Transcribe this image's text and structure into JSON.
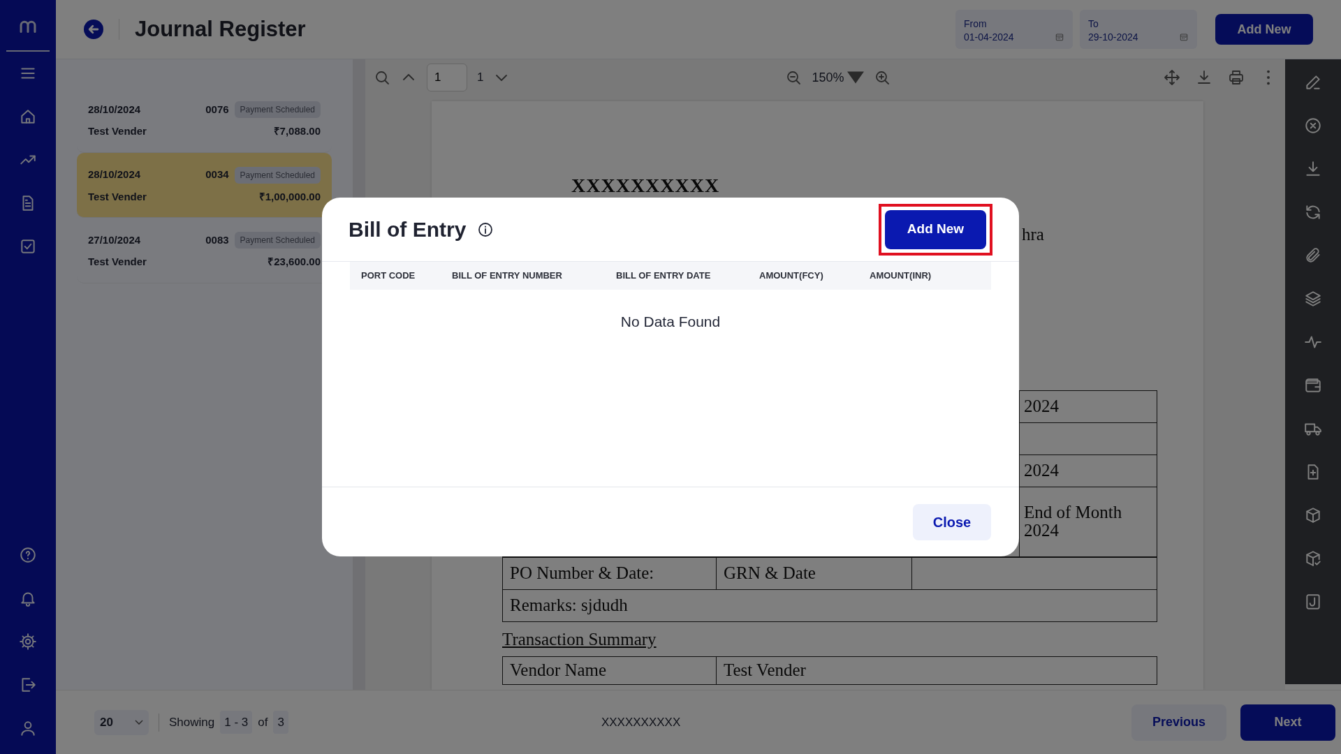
{
  "header": {
    "title": "Journal Register",
    "from": {
      "label": "From",
      "value": "01-04-2024"
    },
    "to": {
      "label": "To",
      "value": "29-10-2024"
    },
    "add_button": "Add New"
  },
  "entries": [
    {
      "date": "28/10/2024",
      "number": "0076",
      "status": "Payment Scheduled",
      "vendor": "Test Vender",
      "amount": "₹7,088.00",
      "selected": false
    },
    {
      "date": "28/10/2024",
      "number": "0034",
      "status": "Payment Scheduled",
      "vendor": "Test Vender",
      "amount": "₹1,00,000.00",
      "selected": true
    },
    {
      "date": "27/10/2024",
      "number": "0083",
      "status": "Payment Scheduled",
      "vendor": "Test Vender",
      "amount": "₹23,600.00",
      "selected": false
    }
  ],
  "viewer": {
    "page": "1",
    "page_count": "1",
    "zoom": "150%"
  },
  "document": {
    "title": "XXXXXXXXXX",
    "address_fragment": "hra",
    "detail_rows": [
      {
        "kind": "value",
        "lines": [
          "2024"
        ]
      },
      {
        "kind": "blank"
      },
      {
        "kind": "value",
        "lines": [
          "2024"
        ]
      },
      {
        "kind": "value",
        "lines": [
          "End of Month",
          "2024"
        ]
      }
    ],
    "po_row": [
      "PO Number & Date:",
      "GRN & Date"
    ],
    "remarks": "Remarks: sjdudh",
    "section_title": "Transaction Summary",
    "summary_rows": [
      [
        "Vendor Name",
        "Test Vender"
      ]
    ]
  },
  "modal": {
    "title": "Bill of Entry",
    "add_button": {
      "label": "Add New",
      "highlighted": true
    },
    "columns": [
      "PORT CODE",
      "BILL OF ENTRY NUMBER",
      "BILL OF ENTRY DATE",
      "AMOUNT(FCY)",
      "AMOUNT(INR)"
    ],
    "empty_text": "No Data Found",
    "close_button": "Close"
  },
  "footer": {
    "page_size": "20",
    "showing_label": "Showing",
    "range": "1 - 3",
    "of_label": "of",
    "total": "3",
    "center_text": "XXXXXXXXXX",
    "previous": "Previous",
    "next": "Next"
  }
}
